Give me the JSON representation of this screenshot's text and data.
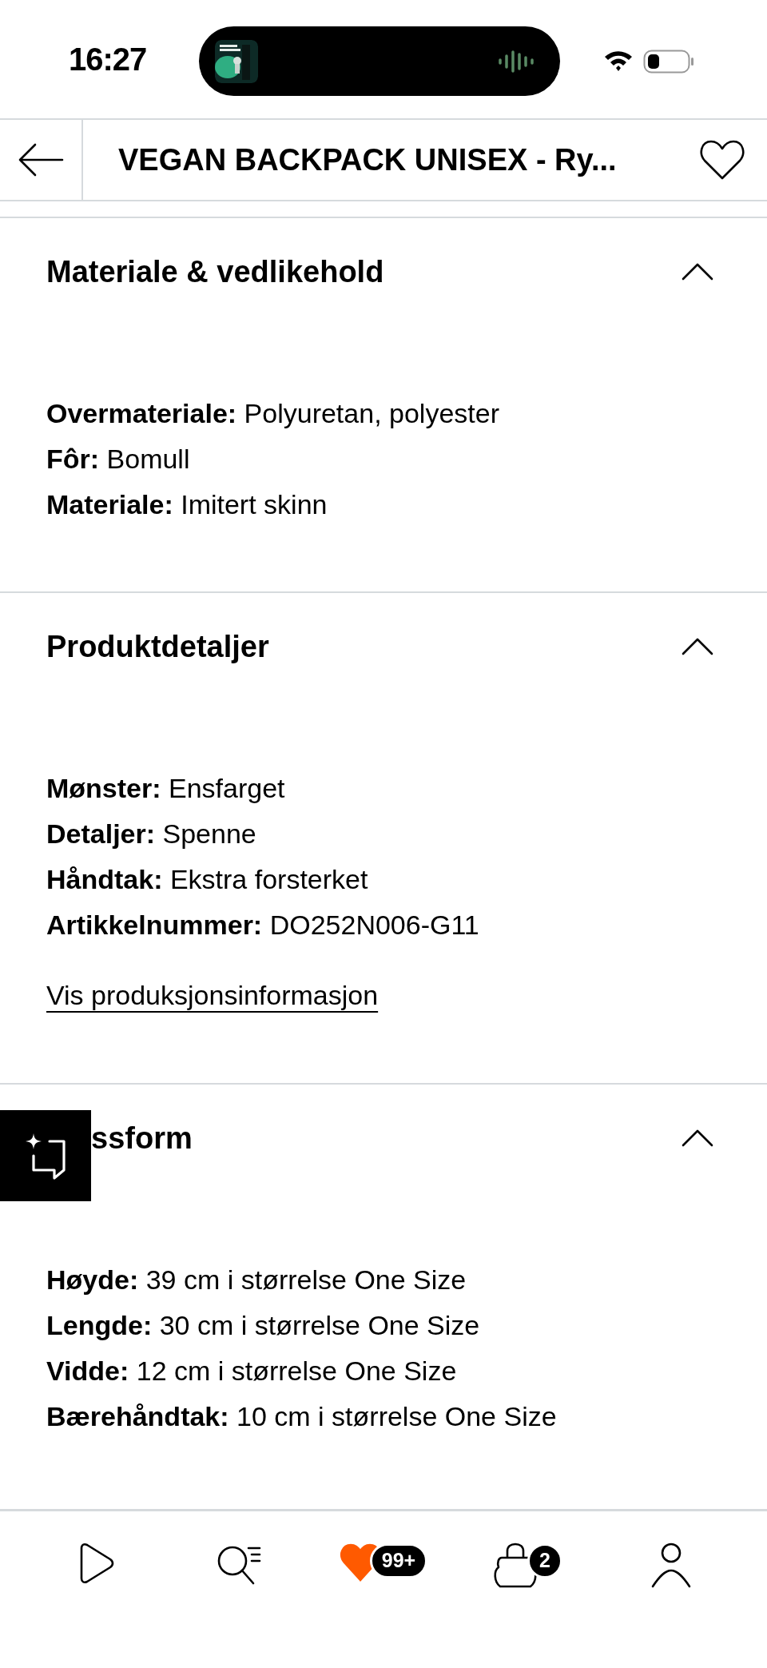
{
  "status_bar": {
    "time": "16:27"
  },
  "header": {
    "title": "VEGAN BACKPACK UNISEX - Ry..."
  },
  "sections": [
    {
      "heading": "Materiale & vedlikehold",
      "expanded": true,
      "items": [
        "**Overmateriale:** Polyuretan, polyester",
        "**Fôr:** Bomull",
        "**Materiale:** Imitert skinn"
      ]
    },
    {
      "heading": "Produktdetaljer",
      "expanded": true,
      "items": [
        "**Mønster:** Ensfarget",
        "**Detaljer:** Spenne",
        "**Håndtak:** Ekstra forsterket",
        "**Artikkelnummer:** DO252N006-G11"
      ],
      "link": "Vis produksjonsinformasjon"
    },
    {
      "heading": "ssform",
      "expanded": true,
      "overlay_button": true,
      "items": [
        "**Høyde:** 39 cm i størrelse One Size",
        "**Lengde:** 30 cm i størrelse One Size",
        "**Vidde:** 12 cm i størrelse One Size",
        "**Bærehåndtak:** 10 cm i størrelse One Size"
      ]
    }
  ],
  "bottom_nav": [
    {
      "kind": "play"
    },
    {
      "kind": "search"
    },
    {
      "kind": "heart",
      "badge": "99+"
    },
    {
      "kind": "bag",
      "badge": "2"
    },
    {
      "kind": "profile"
    }
  ]
}
